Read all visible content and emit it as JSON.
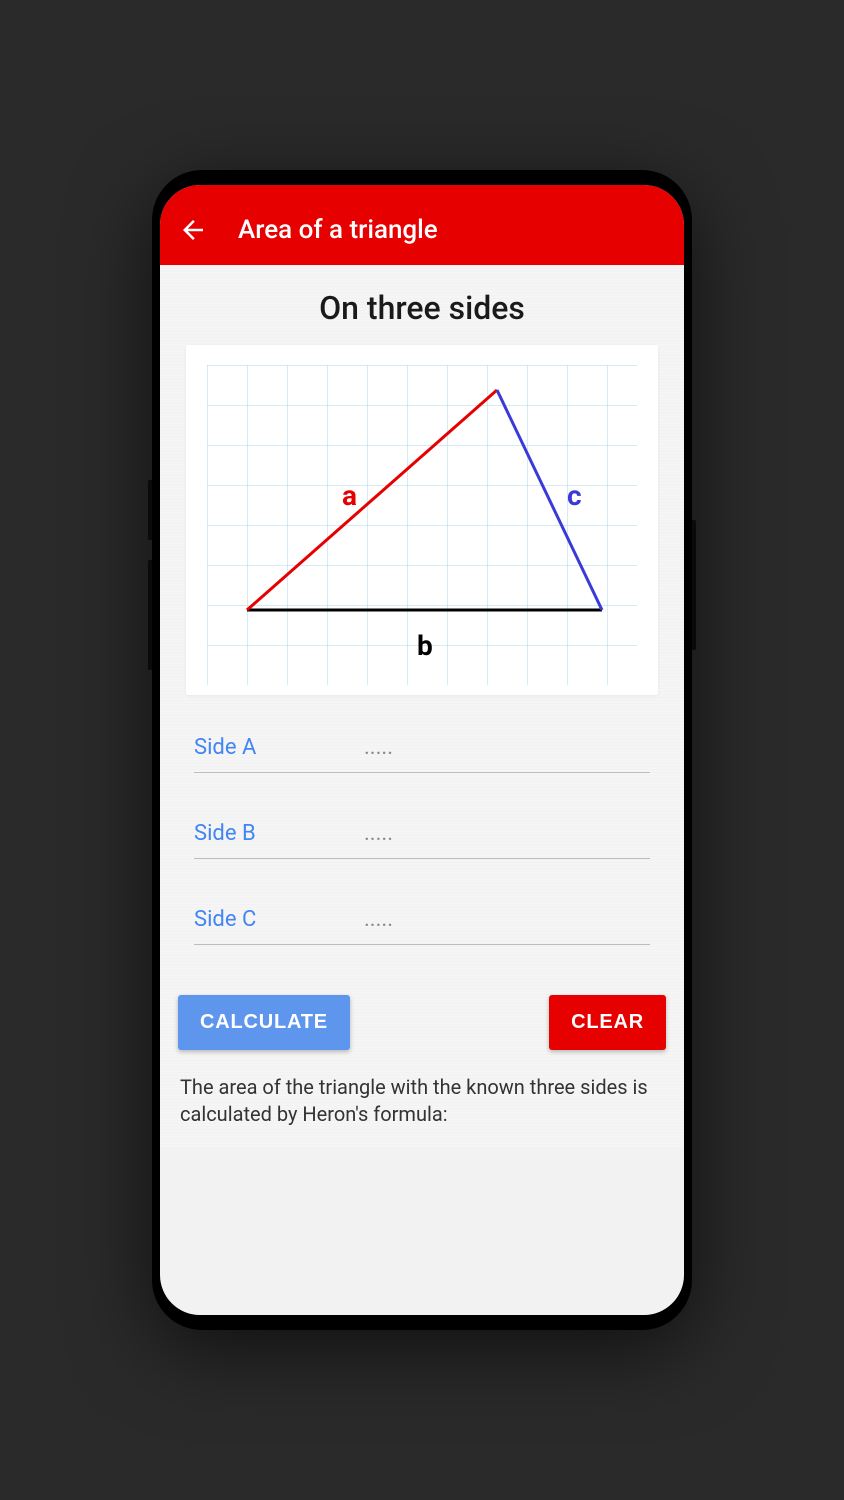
{
  "header": {
    "title": "Area of a triangle"
  },
  "section": {
    "subtitle": "On three sides"
  },
  "diagram": {
    "labels": {
      "a": "a",
      "b": "b",
      "c": "c"
    }
  },
  "inputs": [
    {
      "label": "Side A",
      "placeholder": "....."
    },
    {
      "label": "Side B",
      "placeholder": "....."
    },
    {
      "label": "Side C",
      "placeholder": "....."
    }
  ],
  "buttons": {
    "calculate": "CALCULATE",
    "clear": "CLEAR"
  },
  "description": "The area of the triangle with the known three sides is calculated by Heron's formula:"
}
